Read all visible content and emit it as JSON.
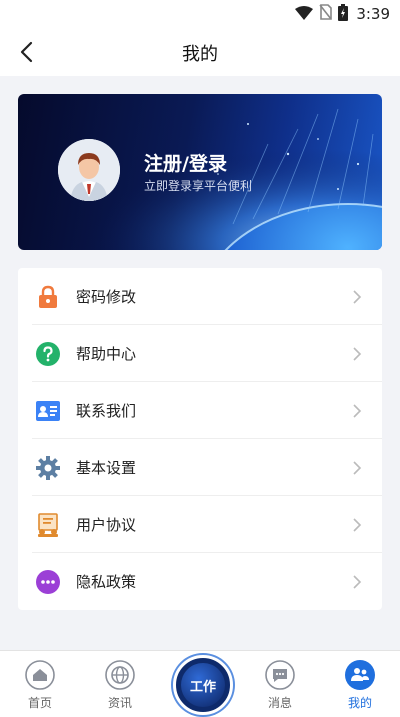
{
  "status_bar": {
    "time": "3:39"
  },
  "nav": {
    "title": "我的",
    "back_icon": "chevron-left-icon"
  },
  "profile": {
    "title": "注册/登录",
    "subtitle": "立即登录享平台便利",
    "avatar_icon": "user-avatar-icon"
  },
  "menu": {
    "items": [
      {
        "label": "密码修改",
        "icon": "lock-icon",
        "color": "#f07a3d"
      },
      {
        "label": "帮助中心",
        "icon": "question-icon",
        "color": "#23b26a"
      },
      {
        "label": "联系我们",
        "icon": "contact-card-icon",
        "color": "#3b82f6"
      },
      {
        "label": "基本设置",
        "icon": "gear-icon",
        "color": "#5d7fa3"
      },
      {
        "label": "用户协议",
        "icon": "agreement-icon",
        "color": "#e08a2e"
      },
      {
        "label": "隐私政策",
        "icon": "more-dots-icon",
        "color": "#9b3fd6"
      }
    ]
  },
  "tabbar": {
    "items": [
      {
        "label": "首页",
        "icon": "home-icon"
      },
      {
        "label": "资讯",
        "icon": "globe-icon"
      },
      {
        "label": "消息",
        "icon": "message-icon"
      },
      {
        "label": "我的",
        "icon": "people-icon",
        "active": true
      }
    ],
    "center": {
      "label": "工作",
      "icon": "work-icon"
    }
  },
  "colors": {
    "accent": "#1f6fde",
    "banner_dark": "#050a2c",
    "banner_light": "#1a57c8"
  }
}
